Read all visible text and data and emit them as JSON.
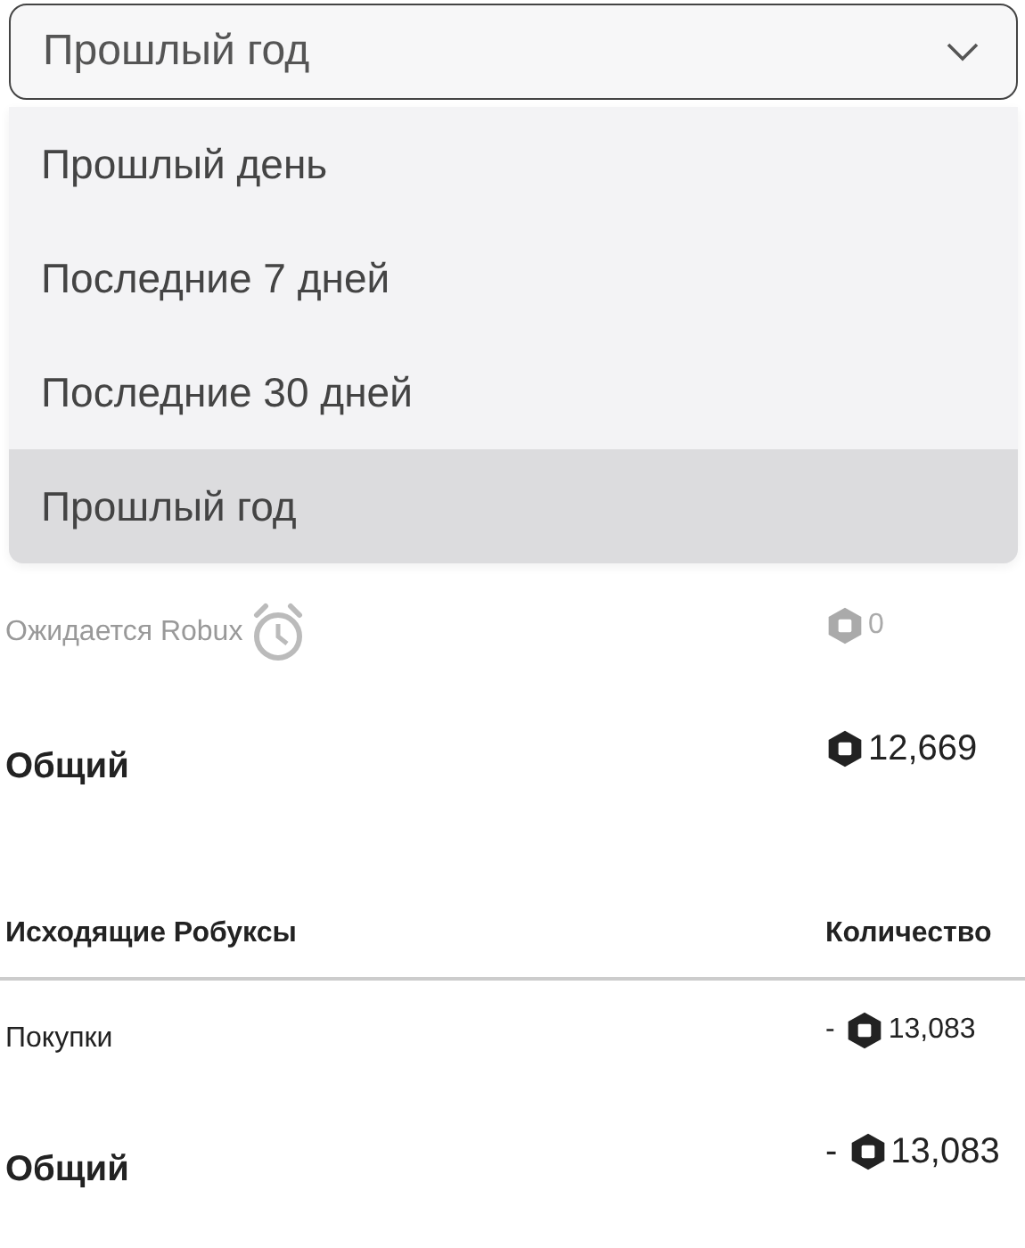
{
  "period_select": {
    "value": "Прошлый год",
    "expanded": true,
    "options": [
      {
        "label": "Прошлый день",
        "selected": false
      },
      {
        "label": "Последние 7 дней",
        "selected": false
      },
      {
        "label": "Последние 30 дней",
        "selected": false
      },
      {
        "label": "Прошлый год",
        "selected": true
      }
    ]
  },
  "incoming": [
    {
      "kind": "pending",
      "label": "Ожидается Robux",
      "amount": "0"
    },
    {
      "kind": "total",
      "label": "Общий",
      "amount": "12,669"
    }
  ],
  "outgoing": {
    "columns": [
      "Исходящие Робуксы",
      "Количество"
    ],
    "rows": [
      {
        "kind": "item",
        "label": "Покупки",
        "sign": "-",
        "amount": "13,083"
      },
      {
        "kind": "total",
        "label": "Общий",
        "sign": "-",
        "amount": "13,083"
      }
    ]
  }
}
